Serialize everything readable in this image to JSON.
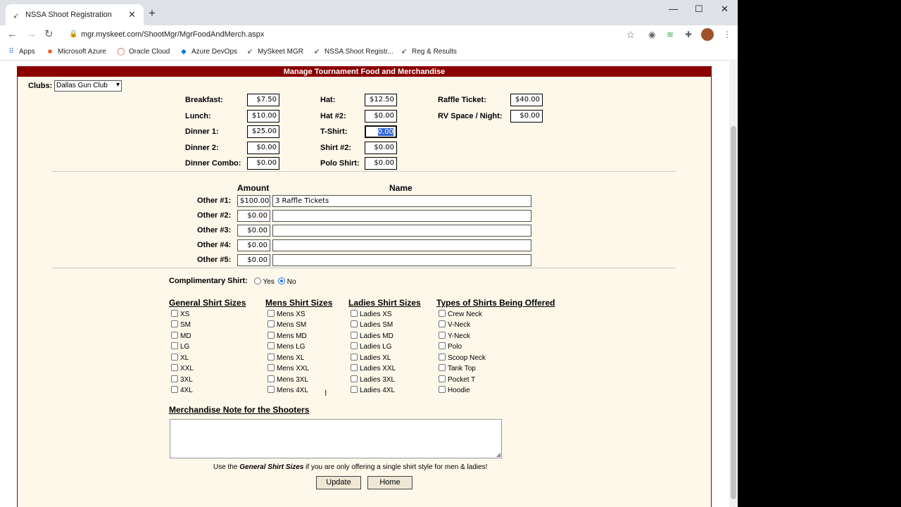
{
  "browser": {
    "tab_title": "NSSA Shoot Registration",
    "url": "mgr.myskeet.com/ShootMgr/MgrFoodAndMerch.aspx",
    "bookmarks": [
      "Apps",
      "Microsoft Azure",
      "Oracle Cloud",
      "Azure DevOps",
      "MySkeet MGR",
      "NSSA Shoot Registr...",
      "Reg & Results"
    ]
  },
  "page": {
    "header": "Manage Tournament Food and Merchandise",
    "clubs_label": "Clubs:",
    "club_selected": "Dallas Gun Club",
    "prices": {
      "col1": [
        {
          "label": "Breakfast:",
          "value": "$7.50"
        },
        {
          "label": "Lunch:",
          "value": "$10.00"
        },
        {
          "label": "Dinner 1:",
          "value": "$25.00"
        },
        {
          "label": "Dinner 2:",
          "value": "$0.00"
        },
        {
          "label": "Dinner Combo:",
          "value": "$0.00"
        }
      ],
      "col2": [
        {
          "label": "Hat:",
          "value": "$12.50"
        },
        {
          "label": "Hat #2:",
          "value": "$0.00"
        },
        {
          "label": "T-Shirt:",
          "value": "0.00"
        },
        {
          "label": "Shirt #2:",
          "value": "$0.00"
        },
        {
          "label": "Polo Shirt:",
          "value": "$0.00"
        }
      ],
      "col3": [
        {
          "label": "Raffle Ticket:",
          "value": "$40.00"
        },
        {
          "label": "RV Space / Night:",
          "value": "$0.00"
        }
      ]
    },
    "other": {
      "amount_header": "Amount",
      "name_header": "Name",
      "rows": [
        {
          "label": "Other #1:",
          "amount": "$100.00",
          "name": "3 Raffle Tickets"
        },
        {
          "label": "Other #2:",
          "amount": "$0.00",
          "name": ""
        },
        {
          "label": "Other #3:",
          "amount": "$0.00",
          "name": ""
        },
        {
          "label": "Other #4:",
          "amount": "$0.00",
          "name": ""
        },
        {
          "label": "Other #5:",
          "amount": "$0.00",
          "name": ""
        }
      ]
    },
    "complimentary": {
      "label": "Complimentary Shirt:",
      "yes": "Yes",
      "no": "No",
      "selected": "No"
    },
    "sizes": {
      "general": {
        "title": "General Shirt Sizes",
        "items": [
          "XS",
          "SM",
          "MD",
          "LG",
          "XL",
          "XXL",
          "3XL",
          "4XL"
        ]
      },
      "mens": {
        "title": "Mens Shirt Sizes",
        "items": [
          "Mens XS",
          "Mens SM",
          "Mens MD",
          "Mens LG",
          "Mens XL",
          "Mens XXL",
          "Mens 3XL",
          "Mens 4XL"
        ]
      },
      "ladies": {
        "title": "Ladies Shirt Sizes",
        "items": [
          "Ladies XS",
          "Ladies SM",
          "Ladies MD",
          "Ladies LG",
          "Ladies XL",
          "Ladies XXL",
          "Ladies 3XL",
          "Ladies 4XL"
        ]
      },
      "types": {
        "title": "Types of Shirts Being Offered",
        "items": [
          "Crew Neck",
          "V-Neck",
          "Y-Neck",
          "Polo",
          "Scoop Neck",
          "Tank Top",
          "Pocket T",
          "Hoodie"
        ]
      }
    },
    "note_title": "Merchandise Note for the Shooters",
    "hint": {
      "pre": "Use the ",
      "em": "General Shirt Sizes",
      "post": " if you are only offering a single shirt style for men & ladies!"
    },
    "buttons": {
      "update": "Update",
      "home": "Home"
    }
  }
}
